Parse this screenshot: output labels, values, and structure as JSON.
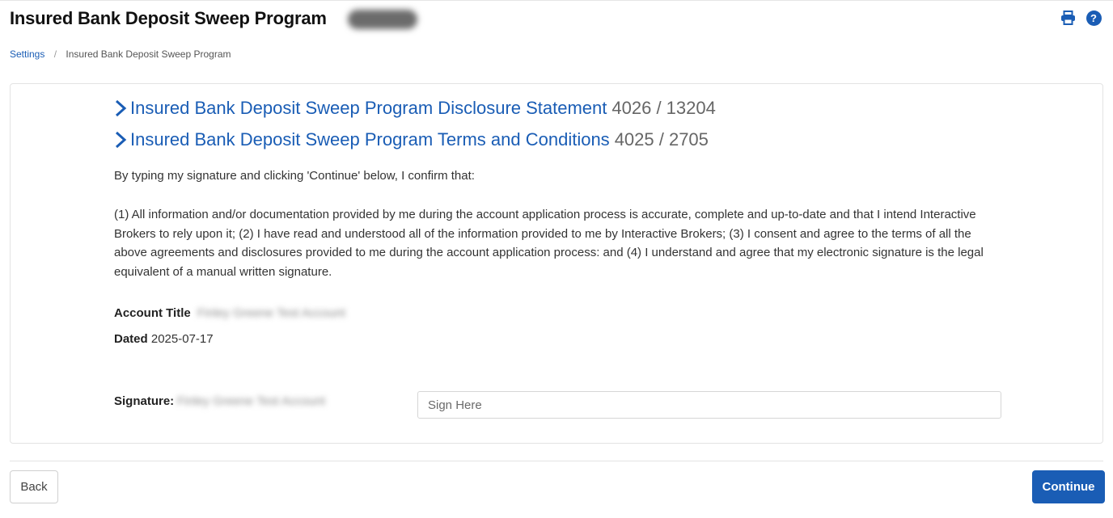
{
  "header": {
    "title": "Insured Bank Deposit Sweep Program",
    "account_badge": "U*******",
    "print_icon": "print-icon",
    "help_icon": "help-icon",
    "help_glyph": "?"
  },
  "breadcrumb": {
    "parent": "Settings",
    "separator": "/",
    "current": "Insured Bank Deposit Sweep Program"
  },
  "documents": [
    {
      "label": "Insured Bank Deposit Sweep Program Disclosure Statement",
      "count": "4026 / 13204"
    },
    {
      "label": "Insured Bank Deposit Sweep Program Terms and Conditions",
      "count": "4025 / 2705"
    }
  ],
  "confirmation": {
    "intro": "By typing my signature and clicking 'Continue' below, I confirm that:",
    "body": "(1) All information and/or documentation provided by me during the account application process is accurate, complete and up-to-date and that I intend Interactive Brokers to rely upon it; (2) I have read and understood all of the information provided to me by Interactive Brokers; (3) I consent and agree to the terms of all the above agreements and disclosures provided to me during the account application process: and (4) I understand and agree that my electronic signature is the legal equivalent of a manual written signature."
  },
  "fields": {
    "account_title_label": "Account Title",
    "account_title_value": "Finley Greene Test Account",
    "dated_label": "Dated",
    "dated_value": "2025-07-17"
  },
  "signature": {
    "label": "Signature:",
    "expected_name": "Finley Greene Test Account",
    "input_value": "",
    "placeholder": "Sign Here"
  },
  "footer": {
    "back_label": "Back",
    "continue_label": "Continue"
  },
  "colors": {
    "accent": "#1a5db5",
    "text": "#333333",
    "border": "#e3e3e3"
  }
}
